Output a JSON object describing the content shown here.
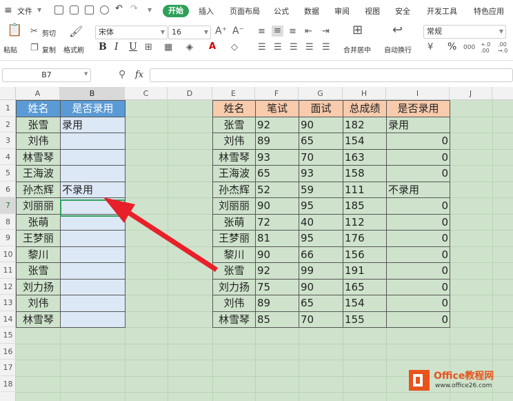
{
  "menubar": {
    "file_label": "文件",
    "tabs": [
      "开始",
      "插入",
      "页面布局",
      "公式",
      "数据",
      "审阅",
      "视图",
      "安全",
      "开发工具",
      "特色应用"
    ]
  },
  "ribbon": {
    "paste": "粘贴",
    "cut": "剪切",
    "copy": "复制",
    "format_painter": "格式刷",
    "font_name": "宋体",
    "font_size": "16",
    "bold": "B",
    "italic": "I",
    "underline": "U",
    "merge_center": "合并居中",
    "wrap_text": "自动换行",
    "number_format": "常规",
    "percent": "%"
  },
  "formula_bar": {
    "cell_ref": "B7",
    "fx": "fx",
    "value": ""
  },
  "sheet": {
    "columns": [
      "A",
      "B",
      "C",
      "D",
      "E",
      "F",
      "G",
      "H",
      "I",
      "J"
    ],
    "rows": [
      "1",
      "2",
      "3",
      "4",
      "5",
      "6",
      "7",
      "8",
      "9",
      "10",
      "11",
      "12",
      "13",
      "14",
      "15",
      "16",
      "17",
      "18"
    ],
    "selected_cell": "B7",
    "table1": {
      "headers": [
        "姓名",
        "是否录用"
      ],
      "rows": [
        [
          "张雪",
          "录用"
        ],
        [
          "刘伟",
          ""
        ],
        [
          "林雪琴",
          ""
        ],
        [
          "王海波",
          ""
        ],
        [
          "孙杰辉",
          "不录用"
        ],
        [
          "刘丽丽",
          ""
        ],
        [
          "张萌",
          ""
        ],
        [
          "王梦丽",
          ""
        ],
        [
          "黎川",
          ""
        ],
        [
          "张雪",
          ""
        ],
        [
          "刘力扬",
          ""
        ],
        [
          "刘伟",
          ""
        ],
        [
          "林雪琴",
          ""
        ]
      ]
    },
    "table2": {
      "headers": [
        "姓名",
        "笔试",
        "面试",
        "总成绩",
        "是否录用"
      ],
      "rows": [
        [
          "张雪",
          "92",
          "90",
          "182",
          "录用"
        ],
        [
          "刘伟",
          "89",
          "65",
          "154",
          "0"
        ],
        [
          "林雪琴",
          "93",
          "70",
          "163",
          "0"
        ],
        [
          "王海波",
          "65",
          "93",
          "158",
          "0"
        ],
        [
          "孙杰辉",
          "52",
          "59",
          "111",
          "不录用"
        ],
        [
          "刘丽丽",
          "90",
          "95",
          "185",
          "0"
        ],
        [
          "张萌",
          "72",
          "40",
          "112",
          "0"
        ],
        [
          "王梦丽",
          "81",
          "95",
          "176",
          "0"
        ],
        [
          "黎川",
          "90",
          "66",
          "156",
          "0"
        ],
        [
          "张雪",
          "92",
          "99",
          "191",
          "0"
        ],
        [
          "刘力扬",
          "75",
          "90",
          "165",
          "0"
        ],
        [
          "刘伟",
          "89",
          "65",
          "154",
          "0"
        ],
        [
          "林雪琴",
          "85",
          "70",
          "155",
          "0"
        ]
      ]
    }
  },
  "watermark": {
    "brand": "Office教程网",
    "url": "www.office26.com"
  },
  "colors": {
    "accent_green": "#2fa05a",
    "header_blue": "#5b9bd5",
    "header_peach": "#f8cbad",
    "arrow_red": "#e8202a",
    "logo_orange": "#e8531d"
  }
}
